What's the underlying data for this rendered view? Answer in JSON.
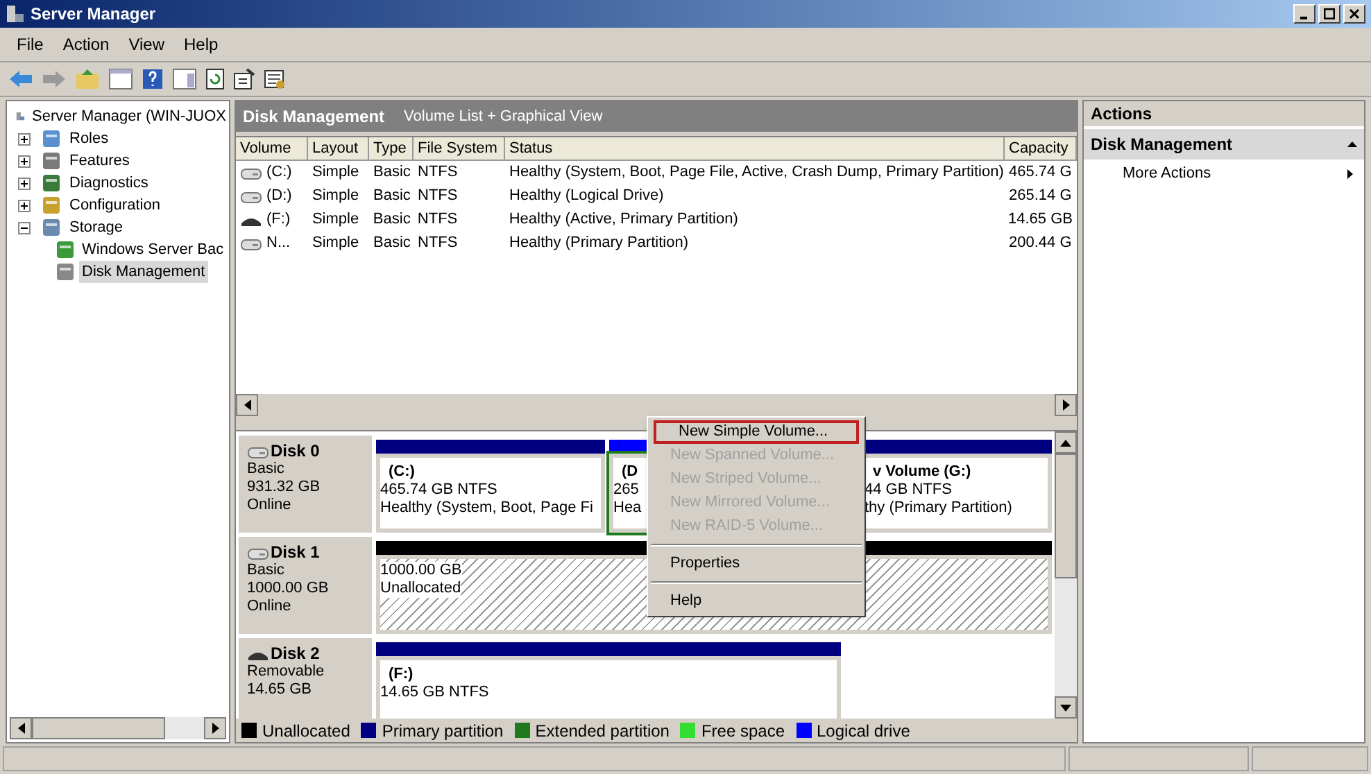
{
  "window": {
    "title": "Server Manager"
  },
  "menu": [
    "File",
    "Action",
    "View",
    "Help"
  ],
  "tree": {
    "label": "Server Manager (WIN-JUOX",
    "selected": false,
    "children": [
      {
        "label": "Roles",
        "expanded": false,
        "selected": false
      },
      {
        "label": "Features",
        "expanded": false,
        "selected": false
      },
      {
        "label": "Diagnostics",
        "expanded": false,
        "selected": false
      },
      {
        "label": "Configuration",
        "expanded": false,
        "selected": false
      },
      {
        "label": "Storage",
        "expanded": true,
        "selected": false,
        "children": [
          {
            "label": "Windows Server Bac",
            "selected": false
          },
          {
            "label": "Disk Management",
            "selected": true
          }
        ]
      }
    ]
  },
  "center": {
    "title": "Disk Management",
    "subtitle": "Volume List + Graphical View"
  },
  "table": {
    "columns": [
      "Volume",
      "Layout",
      "Type",
      "File System",
      "Status",
      "Capacity"
    ],
    "rows": [
      {
        "kind": "fixed",
        "cells": [
          "(C:)",
          "Simple",
          "Basic",
          "NTFS",
          "Healthy (System, Boot, Page File, Active, Crash Dump, Primary Partition)",
          "465.74 G"
        ]
      },
      {
        "kind": "fixed",
        "cells": [
          "(D:)",
          "Simple",
          "Basic",
          "NTFS",
          "Healthy (Logical Drive)",
          "265.14 G"
        ]
      },
      {
        "kind": "removable",
        "cells": [
          "(F:)",
          "Simple",
          "Basic",
          "NTFS",
          "Healthy (Active, Primary Partition)",
          "14.65 GB"
        ]
      },
      {
        "kind": "fixed",
        "cells": [
          "N...",
          "Simple",
          "Basic",
          "NTFS",
          "Healthy (Primary Partition)",
          "200.44 G"
        ]
      }
    ]
  },
  "disks": [
    {
      "name": "Disk 0",
      "kind": "fixed",
      "lines": [
        "Basic",
        "931.32 GB",
        "Online"
      ],
      "partitions": [
        {
          "kind": "primary",
          "lines": [
            "(C:)",
            "465.74 GB NTFS",
            "Healthy (System, Boot, Page Fi"
          ]
        },
        {
          "kind": "logical",
          "lines": [
            "(D",
            "265",
            "Hea"
          ]
        },
        {
          "kind": "primary",
          "lines": [
            "v Volume  (G:)",
            "44 GB NTFS",
            "thy (Primary Partition)"
          ]
        }
      ]
    },
    {
      "name": "Disk 1",
      "kind": "fixed",
      "lines": [
        "Basic",
        "1000.00 GB",
        "Online"
      ],
      "partitions": [
        {
          "kind": "unallocated",
          "lines": [
            "1000.00 GB",
            "Unallocated"
          ]
        }
      ]
    },
    {
      "name": "Disk 2",
      "kind": "removable",
      "lines": [
        "Removable",
        "14.65 GB"
      ],
      "partitions": [
        {
          "kind": "primary",
          "lines": [
            "(F:)",
            "14.65 GB NTFS"
          ]
        }
      ]
    }
  ],
  "legend": [
    {
      "label": "Unallocated",
      "color": "#000000"
    },
    {
      "label": "Primary partition",
      "color": "#000080"
    },
    {
      "label": "Extended partition",
      "color": "#1f7a1f"
    },
    {
      "label": "Free space",
      "color": "#33dd33"
    },
    {
      "label": "Logical drive",
      "color": "#0000ff"
    }
  ],
  "context_menu": [
    {
      "label": "New Simple Volume...",
      "disabled": false,
      "highlighted": true,
      "separator_before": false
    },
    {
      "label": "New Spanned Volume...",
      "disabled": true,
      "highlighted": false,
      "separator_before": false
    },
    {
      "label": "New Striped Volume...",
      "disabled": true,
      "highlighted": false,
      "separator_before": false
    },
    {
      "label": "New Mirrored Volume...",
      "disabled": true,
      "highlighted": false,
      "separator_before": false
    },
    {
      "label": "New RAID-5 Volume...",
      "disabled": true,
      "highlighted": false,
      "separator_before": false
    },
    {
      "label": "Properties",
      "disabled": false,
      "highlighted": false,
      "separator_before": true
    },
    {
      "label": "Help",
      "disabled": false,
      "highlighted": false,
      "separator_before": true
    }
  ],
  "actions": {
    "title": "Actions",
    "section": "Disk Management",
    "expanded": true,
    "items": [
      "More Actions"
    ]
  }
}
